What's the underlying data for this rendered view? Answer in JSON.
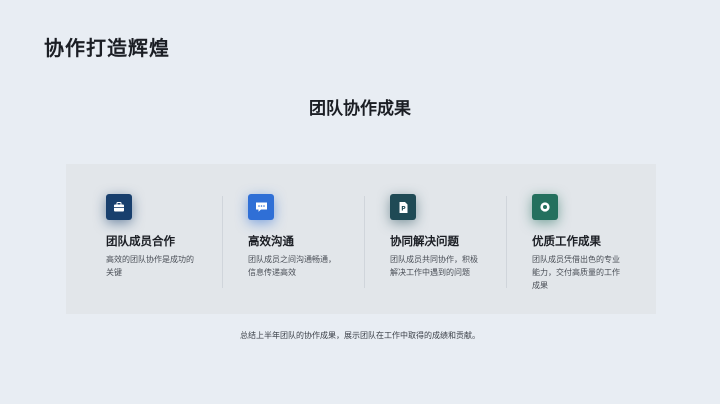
{
  "slide": {
    "title": "协作打造辉煌",
    "section_title": "团队协作成果",
    "summary": "总结上半年团队的协作成果，展示团队在工作中取得的成绩和贡献。"
  },
  "cards": [
    {
      "title": "团队成员合作",
      "description": "高效的团队协作是成功的关键",
      "icon": "briefcase-icon",
      "color": "#183f6d"
    },
    {
      "title": "高效沟通",
      "description": "团队成员之间沟通畅通，信息传递高效",
      "icon": "chat-icon",
      "color": "#2f6fd6"
    },
    {
      "title": "协同解决问题",
      "description": "团队成员共同协作，积极解决工作中遇到的问题",
      "icon": "document-icon",
      "color": "#1f4a55"
    },
    {
      "title": "优质工作成果",
      "description": "团队成员凭借出色的专业能力，交付高质量的工作成果",
      "icon": "target-icon",
      "color": "#24705e"
    }
  ]
}
